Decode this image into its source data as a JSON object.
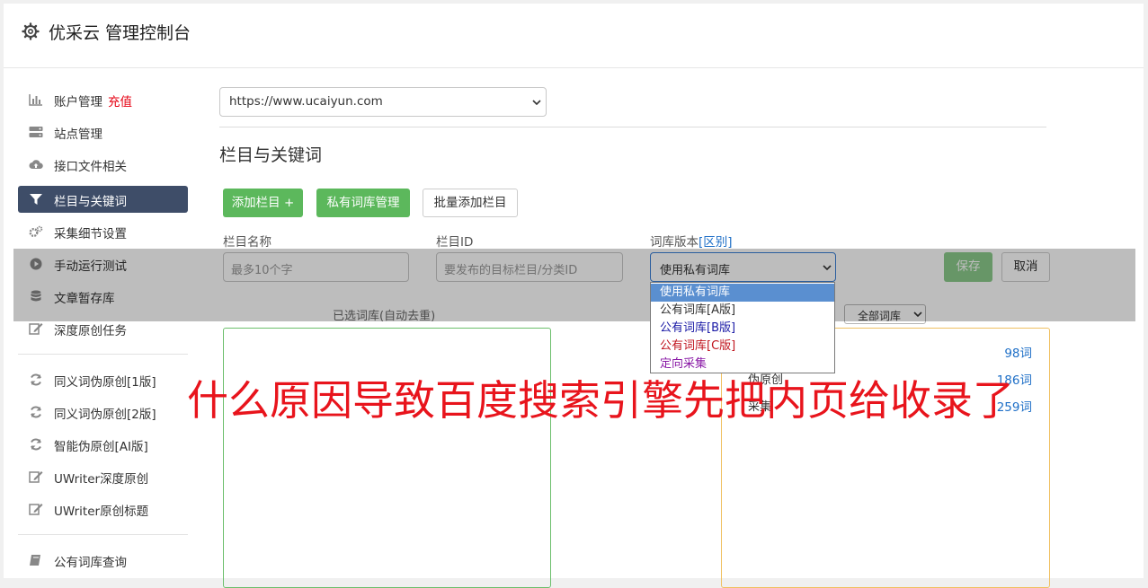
{
  "app": {
    "title": "优采云 管理控制台"
  },
  "sidebar": {
    "items": [
      {
        "label": "账户管理",
        "badge": "充值",
        "icon": "bar-chart-icon"
      },
      {
        "label": "站点管理",
        "icon": "server-icon"
      },
      {
        "label": "接口文件相关",
        "icon": "cloud-upload-icon"
      },
      {
        "label": "栏目与关键词",
        "icon": "filter-icon",
        "active": true
      },
      {
        "label": "采集细节设置",
        "icon": "cogs-icon"
      },
      {
        "label": "手动运行测试",
        "icon": "play-circle-icon"
      },
      {
        "label": "文章暂存库",
        "icon": "database-icon"
      },
      {
        "label": "深度原创任务",
        "icon": "edit-icon"
      },
      {
        "label": "同义词伪原创[1版]",
        "icon": "refresh-icon"
      },
      {
        "label": "同义词伪原创[2版]",
        "icon": "refresh-icon"
      },
      {
        "label": "智能伪原创[AI版]",
        "icon": "refresh-icon"
      },
      {
        "label": "UWriter深度原创",
        "icon": "edit-icon"
      },
      {
        "label": "UWriter原创标题",
        "icon": "edit-icon"
      },
      {
        "label": "公有词库查询",
        "icon": "book-icon"
      }
    ]
  },
  "site_select": {
    "value": "https://www.ucaiyun.com"
  },
  "section": {
    "title": "栏目与关键词"
  },
  "toolbar": {
    "add_column": "添加栏目 +",
    "private_lib": "私有词库管理",
    "batch_add": "批量添加栏目"
  },
  "form": {
    "name_label": "栏目名称",
    "name_placeholder": "最多10个字",
    "id_label": "栏目ID",
    "id_placeholder": "要发布的目标栏目/分类ID",
    "version_label": "词库版本",
    "version_link": "[区别]",
    "version_value": "使用私有词库",
    "save": "保存",
    "cancel": "取消"
  },
  "dropdown": {
    "options": [
      {
        "label": "使用私有词库",
        "color": "#ffffff"
      },
      {
        "label": "公有词库[A版]",
        "color": "#333333"
      },
      {
        "label": "公有词库[B版]",
        "color": "#1a1aa6"
      },
      {
        "label": "公有词库[C版]",
        "color": "#c0141e"
      },
      {
        "label": "定向采集",
        "color": "#8a1aa6"
      }
    ]
  },
  "selected_box": {
    "caption": "已选词库(自动去重)"
  },
  "filter": {
    "value": "全部词库"
  },
  "library_rows": [
    {
      "name": "",
      "count": "98词"
    },
    {
      "name": "伪原创",
      "count": "186词"
    },
    {
      "name": "采集",
      "count": "259词"
    }
  ],
  "overlay_text": "什么原因导致百度搜索引擎先把内页给收录了",
  "colors": {
    "accent_green": "#5cb85c",
    "active_nav": "#3e4d68",
    "link": "#1e6fc7",
    "overlay_red": "#e8141c"
  }
}
